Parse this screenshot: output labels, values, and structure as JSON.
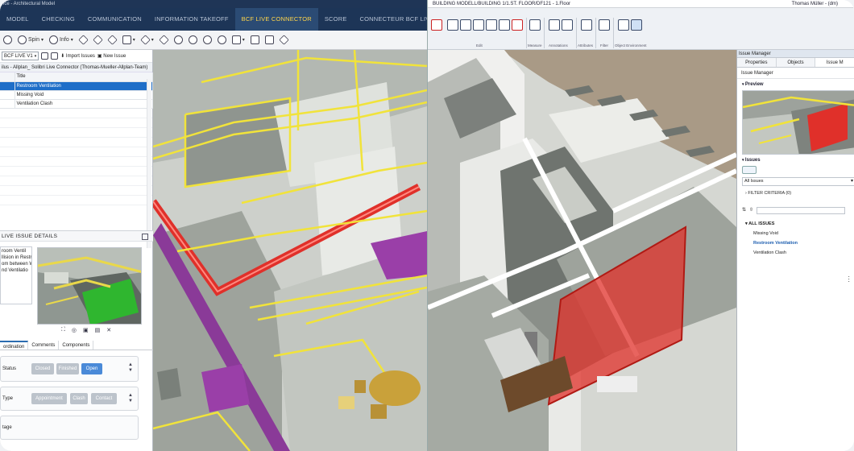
{
  "left_app": {
    "title": "ice - Architectural Model",
    "tabs": [
      "MODEL",
      "CHECKING",
      "COMMUNICATION",
      "INFORMATION TAKEOFF",
      "BCF LIVE CONNECTOR",
      "SCORE",
      "CONNECTEUR BCF LIVE"
    ],
    "active_tab": "BCF LIVE CONNECTOR",
    "tab_plus": "+",
    "toolbar": {
      "spin_label": "Spin",
      "info_label": "Info"
    },
    "panel": {
      "selector_label": "BCF LIVE V1",
      "import_label": "Import Issues",
      "new_issue_label": "New Issue",
      "project_label": "ilus - Allplan_ Solibri Live Connector (Thomas-Mueller-Allplan-Team)",
      "column_header": "Title",
      "issues": [
        {
          "title": "Restroom Ventilation",
          "selected": true
        },
        {
          "title": "Missing Void",
          "selected": false
        },
        {
          "title": "Ventilation Clash",
          "selected": false
        }
      ]
    },
    "details": {
      "header": "LIVE ISSUE DETAILS",
      "description_lines": [
        "room Ventil",
        "",
        "llision in Restr",
        "om between W",
        "nd Ventilatio"
      ],
      "tabs": [
        "ordination",
        "Comments",
        "Components"
      ],
      "status_label": "Status",
      "status_options": [
        "Closed",
        "Finished",
        "Open"
      ],
      "status_selected": "Open",
      "type_label": "Type",
      "type_options": [
        "Appointment",
        "Clash",
        "Contact"
      ],
      "stage_label": "tage"
    }
  },
  "right_app": {
    "breadcrumb": "BUILDING MODELL/BUILDING 1/1.ST. FLOOR/DF121 - 1.Floor",
    "user": "Thomas Müller - (dm)",
    "ribbon_groups": [
      "Edit",
      "Measure",
      "Annotations",
      "Attributes",
      "Filter",
      "Object Environment"
    ],
    "side_panel": {
      "header": "Issue Manager",
      "tabs": [
        "Properties",
        "Objects",
        "Issue M"
      ],
      "crumb": "Issue Manager",
      "preview_label": "Preview",
      "issues_label": "Issues",
      "issues_combo": "All Issues",
      "filter_label": "FILTER CRITERIA (0)",
      "all_issues_label": "ALL ISSUES",
      "issues": [
        {
          "title": "Missing Void",
          "active": false
        },
        {
          "title": "Restroom Ventilation",
          "active": true
        },
        {
          "title": "Ventilation Clash",
          "active": false
        }
      ]
    }
  },
  "colors": {
    "title_bar": "#1f3556",
    "active_tab_text": "#ffd54a",
    "selection_blue": "#1e6ec8",
    "clash_red": "#e0302a",
    "duct_yellow": "#f1e33a",
    "duct_purple": "#9a3fa8",
    "success_green": "#2fb62f"
  }
}
